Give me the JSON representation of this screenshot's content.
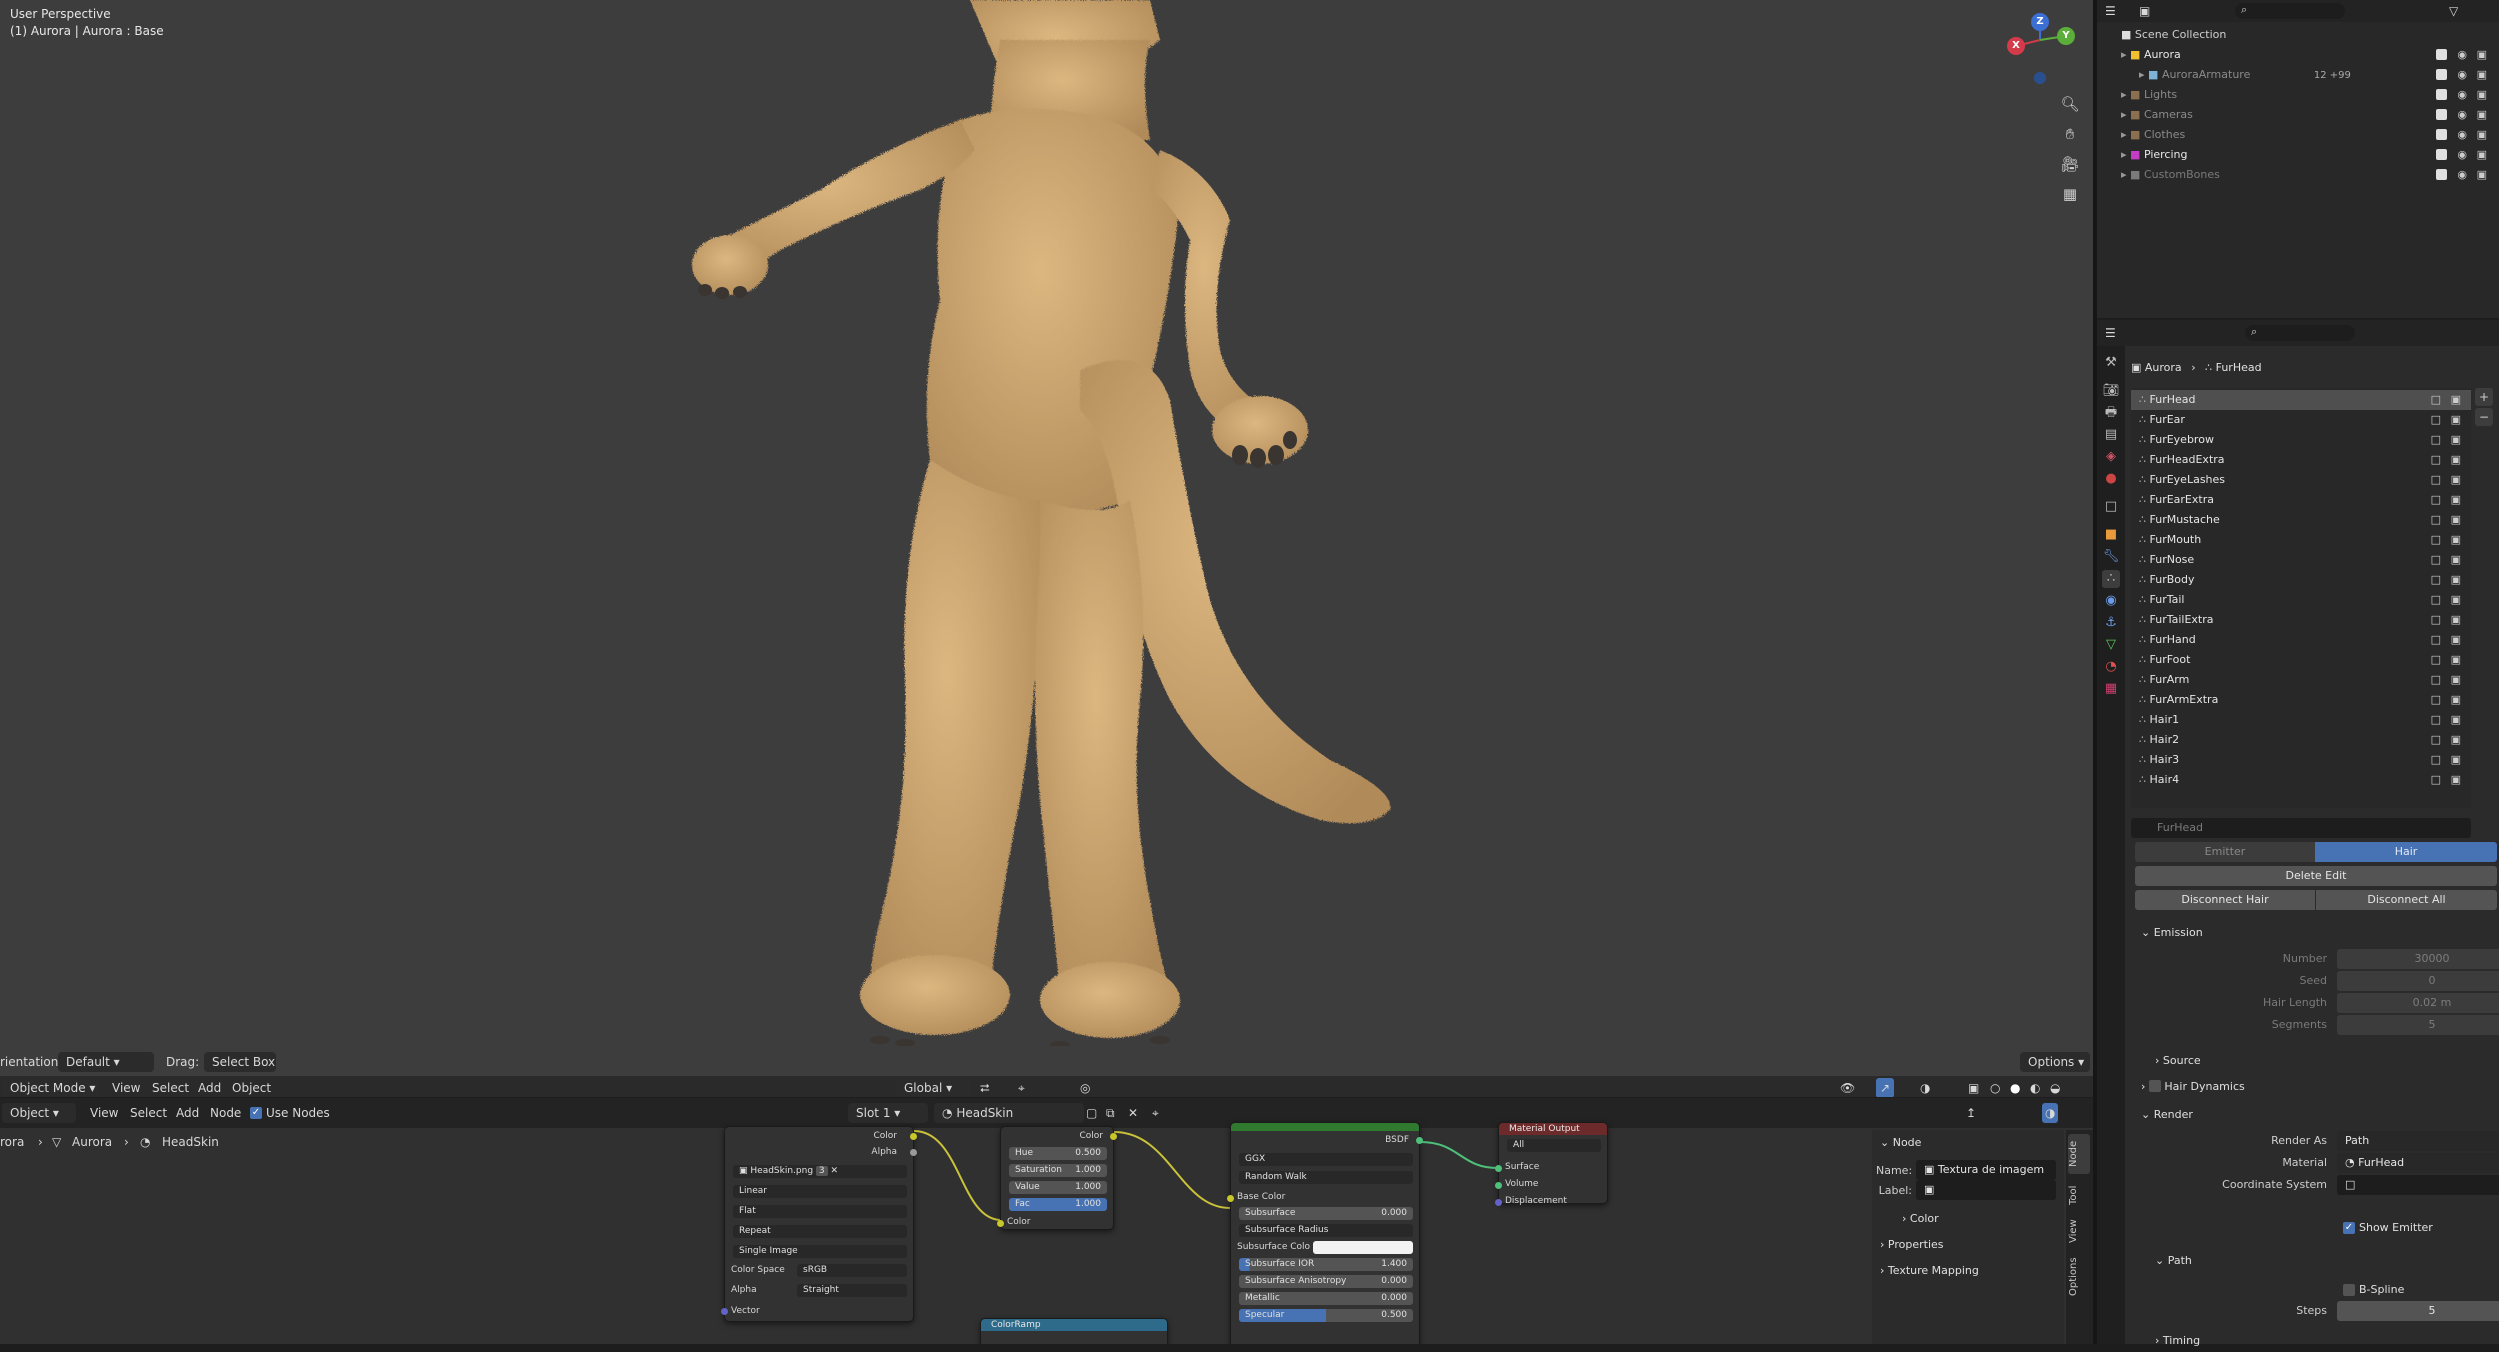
{
  "viewport": {
    "perspective": "User Perspective",
    "context": "(1) Aurora | Aurora : Base",
    "gizmo": {
      "x": "X",
      "y": "Y",
      "z": "Z"
    },
    "header": {
      "orientation_label": "rientation:",
      "orientation_value": "Default",
      "drag_label": "Drag:",
      "drag_value": "Select Box",
      "options": "Options",
      "mode": "Object Mode",
      "menus": [
        "View",
        "Select",
        "Add",
        "Object"
      ],
      "transform": "Global"
    }
  },
  "node_editor": {
    "header": {
      "type": "Object",
      "menus": [
        "View",
        "Select",
        "Add",
        "Node"
      ],
      "use_nodes": "Use Nodes",
      "slot": "Slot 1",
      "material": "HeadSkin"
    },
    "breadcrumb": [
      "rora",
      "Aurora",
      "HeadSkin"
    ],
    "image_node": {
      "out_color": "Color",
      "out_alpha": "Alpha",
      "image": "HeadSkin.png",
      "users": "3",
      "interpolation": "Linear",
      "projection": "Flat",
      "extension": "Repeat",
      "source": "Single Image",
      "color_space_label": "Color Space",
      "color_space": "sRGB",
      "alpha_label": "Alpha",
      "alpha": "Straight",
      "in_vector": "Vector"
    },
    "hsv_node": {
      "out_color": "Color",
      "hue_label": "Hue",
      "hue": "0.500",
      "sat_label": "Saturation",
      "sat": "1.000",
      "val_label": "Value",
      "val": "1.000",
      "fac_label": "Fac",
      "fac": "1.000",
      "in_color": "Color"
    },
    "bsdf_node": {
      "out_bsdf": "BSDF",
      "distribution": "GGX",
      "subsurface_method": "Random Walk",
      "base_color": "Base Color",
      "subsurface_label": "Subsurface",
      "subsurface": "0.000",
      "subsurface_radius": "Subsurface Radius",
      "subsurface_color": "Subsurface Colo",
      "subsurface_ior_label": "Subsurface IOR",
      "subsurface_ior": "1.400",
      "subsurface_aniso_label": "Subsurface Anisotropy",
      "subsurface_aniso": "0.000",
      "metallic_label": "Metallic",
      "metallic": "0.000",
      "specular_label": "Specular",
      "specular": "0.500",
      "specular_fill": 0.5
    },
    "output_node": {
      "title": "Material Output",
      "target": "All",
      "surface": "Surface",
      "volume": "Volume",
      "displacement": "Displacement"
    },
    "colorramp_node": {
      "title": "ColorRamp"
    },
    "sidebar": {
      "panel": "Node",
      "name_label": "Name:",
      "name_value": "Textura de imagem",
      "label_label": "Label:",
      "color": "Color",
      "properties": "Properties",
      "texture_mapping": "Texture Mapping"
    },
    "tabs": [
      "Node",
      "Tool",
      "View",
      "Options"
    ]
  },
  "outliner": {
    "root": "Scene Collection",
    "items": [
      {
        "name": "Aurora",
        "color": "#e8e8e8",
        "icon_color": "#f0c030",
        "level": 0
      },
      {
        "name": "AuroraArmature",
        "color": "#8a8a8a",
        "icon_color": "#7db3d6",
        "level": 1,
        "extra": "12 +99"
      },
      {
        "name": "Lights",
        "color": "#8a8a8a",
        "icon_color": "#8a7050",
        "level": 0
      },
      {
        "name": "Cameras",
        "color": "#8a8a8a",
        "icon_color": "#8a7050",
        "level": 0
      },
      {
        "name": "Clothes",
        "color": "#8a8a8a",
        "icon_color": "#8a7050",
        "level": 0
      },
      {
        "name": "Piercing",
        "color": "#e8e8e8",
        "icon_color": "#c53cc5",
        "level": 0
      },
      {
        "name": "CustomBones",
        "color": "#7a7a7a",
        "icon_color": "#7a7a7a",
        "level": 0
      }
    ]
  },
  "properties": {
    "breadcrumb": [
      "Aurora",
      "FurHead"
    ],
    "particle_systems": [
      "FurHead",
      "FurEar",
      "FurEyebrow",
      "FurHeadExtra",
      "FurEyeLashes",
      "FurEarExtra",
      "FurMustache",
      "FurMouth",
      "FurNose",
      "FurBody",
      "FurTail",
      "FurTailExtra",
      "FurHand",
      "FurFoot",
      "FurArm",
      "FurArmExtra",
      "Hair1",
      "Hair2",
      "Hair3",
      "Hair4"
    ],
    "settings_name": "FurHead",
    "type_emitter": "Emitter",
    "type_hair": "Hair",
    "delete_edit": "Delete Edit",
    "disconnect_hair": "Disconnect Hair",
    "disconnect_all": "Disconnect All",
    "emission": {
      "title": "Emission",
      "number_label": "Number",
      "number": "30000",
      "seed_label": "Seed",
      "seed": "0",
      "hair_length_label": "Hair Length",
      "hair_length": "0.02 m",
      "segments_label": "Segments",
      "segments": "5"
    },
    "source": "Source",
    "hair_dynamics": "Hair Dynamics",
    "render": {
      "title": "Render",
      "render_as_label": "Render As",
      "render_as": "Path",
      "material_label": "Material",
      "material": "FurHead",
      "coord_label": "Coordinate System",
      "show_emitter": "Show Emitter"
    },
    "path": {
      "title": "Path",
      "bspline": "B-Spline",
      "steps_label": "Steps",
      "steps": "5"
    },
    "timing": "Timing"
  },
  "colors": {
    "accent": "#4772b3",
    "bsdf_header": "#2f7a2f",
    "output_header": "#6d2a2a",
    "ramp_header": "#2e6b8a",
    "fur": "#d2ad78",
    "link": "#c9c23a",
    "shader_link": "#4fc07a"
  }
}
